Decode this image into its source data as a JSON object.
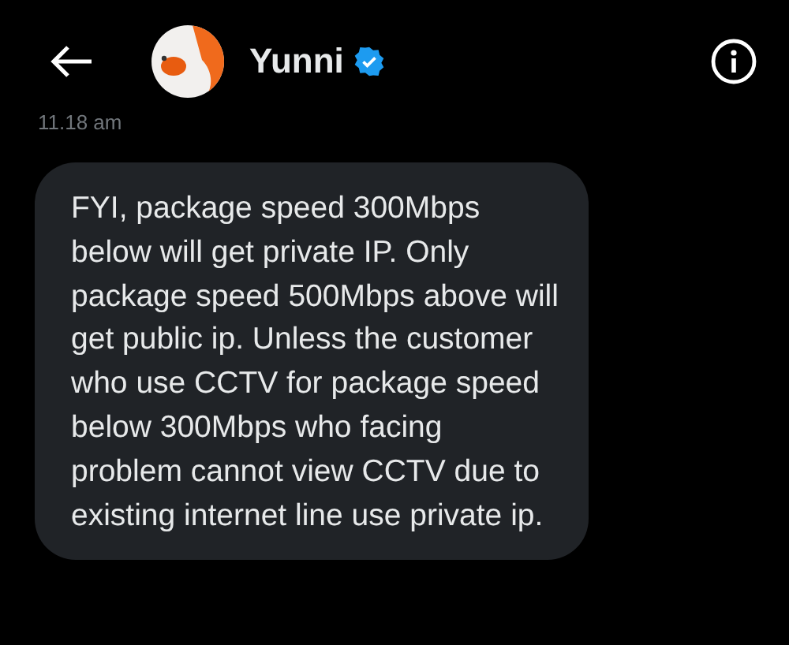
{
  "header": {
    "name": "Yunni",
    "verified": true
  },
  "messages": [
    {
      "time": "11.18 am",
      "text": "FYI, package speed 300Mbps below will get private IP. Only package speed 500Mbps above will get public ip. Unless the customer who use CCTV for package speed below 300Mbps who facing problem cannot view CCTV due to existing internet line use private ip."
    }
  ]
}
